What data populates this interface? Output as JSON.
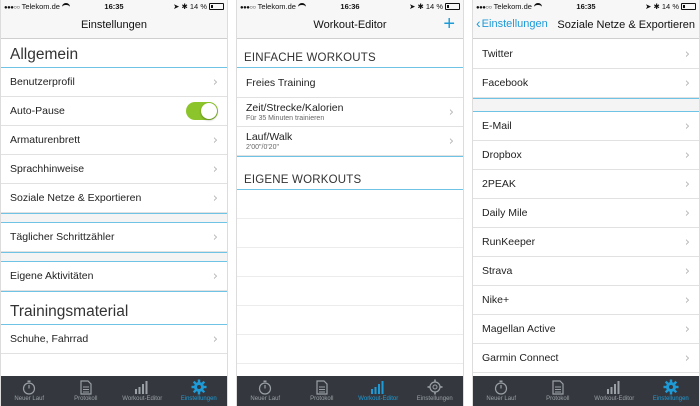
{
  "colors": {
    "accent": "#1e9ad7",
    "toggle_on": "#8cc52b",
    "tabbar_bg": "#34383e",
    "separator_blue": "#6fc4e6"
  },
  "status": {
    "carrier": "Telekom.de",
    "battery": "14 %"
  },
  "screens": [
    {
      "time": "16:35",
      "nav": {
        "title": "Einstellungen"
      },
      "sections": [
        {
          "header": "Allgemein",
          "rows": [
            {
              "label": "Benutzerprofil"
            },
            {
              "label": "Auto-Pause",
              "toggle": true
            },
            {
              "label": "Armaturenbrett"
            },
            {
              "label": "Sprachhinweise"
            },
            {
              "label": "Soziale Netze & Exportieren"
            }
          ]
        },
        {
          "rows": [
            {
              "label": "Täglicher Schrittzähler"
            }
          ]
        },
        {
          "rows": [
            {
              "label": "Eigene Aktivitäten"
            }
          ]
        },
        {
          "header": "Trainingsmaterial",
          "rows": [
            {
              "label": "Schuhe, Fahrrad"
            }
          ]
        }
      ]
    },
    {
      "time": "16:36",
      "nav": {
        "title": "Workout-Editor",
        "action": "+"
      },
      "sections": [
        {
          "header": "EINFACHE WORKOUTS",
          "rows": [
            {
              "label": "Freies Training"
            },
            {
              "label": "Zeit/Strecke/Kalorien",
              "sub": "Für 35 Minuten trainieren"
            },
            {
              "label": "Lauf/Walk",
              "sub": "2'00\"/0'20\""
            }
          ]
        },
        {
          "header": "EIGENE WORKOUTS",
          "rows": []
        }
      ]
    },
    {
      "time": "16:35",
      "nav": {
        "back": "Einstellungen",
        "title": "Soziale Netze & Exportieren"
      },
      "sections": [
        {
          "rows": [
            {
              "label": "Twitter"
            },
            {
              "label": "Facebook"
            }
          ]
        },
        {
          "rows": [
            {
              "label": "E-Mail"
            },
            {
              "label": "Dropbox"
            },
            {
              "label": "2PEAK"
            },
            {
              "label": "Daily Mile"
            },
            {
              "label": "RunKeeper"
            },
            {
              "label": "Strava"
            },
            {
              "label": "Nike+"
            },
            {
              "label": "Magellan Active"
            },
            {
              "label": "Garmin Connect"
            }
          ]
        }
      ]
    }
  ],
  "tabbar": {
    "tabs": [
      {
        "label": "Neuer Lauf",
        "icon": "stopwatch-icon"
      },
      {
        "label": "Protokoll",
        "icon": "document-icon"
      },
      {
        "label": "Workout-Editor",
        "icon": "bar-chart-icon"
      },
      {
        "label": "Einstellungen",
        "icon": "gear-icon"
      }
    ],
    "active_by_screen": [
      "Einstellungen",
      "Workout-Editor",
      "Einstellungen"
    ]
  }
}
